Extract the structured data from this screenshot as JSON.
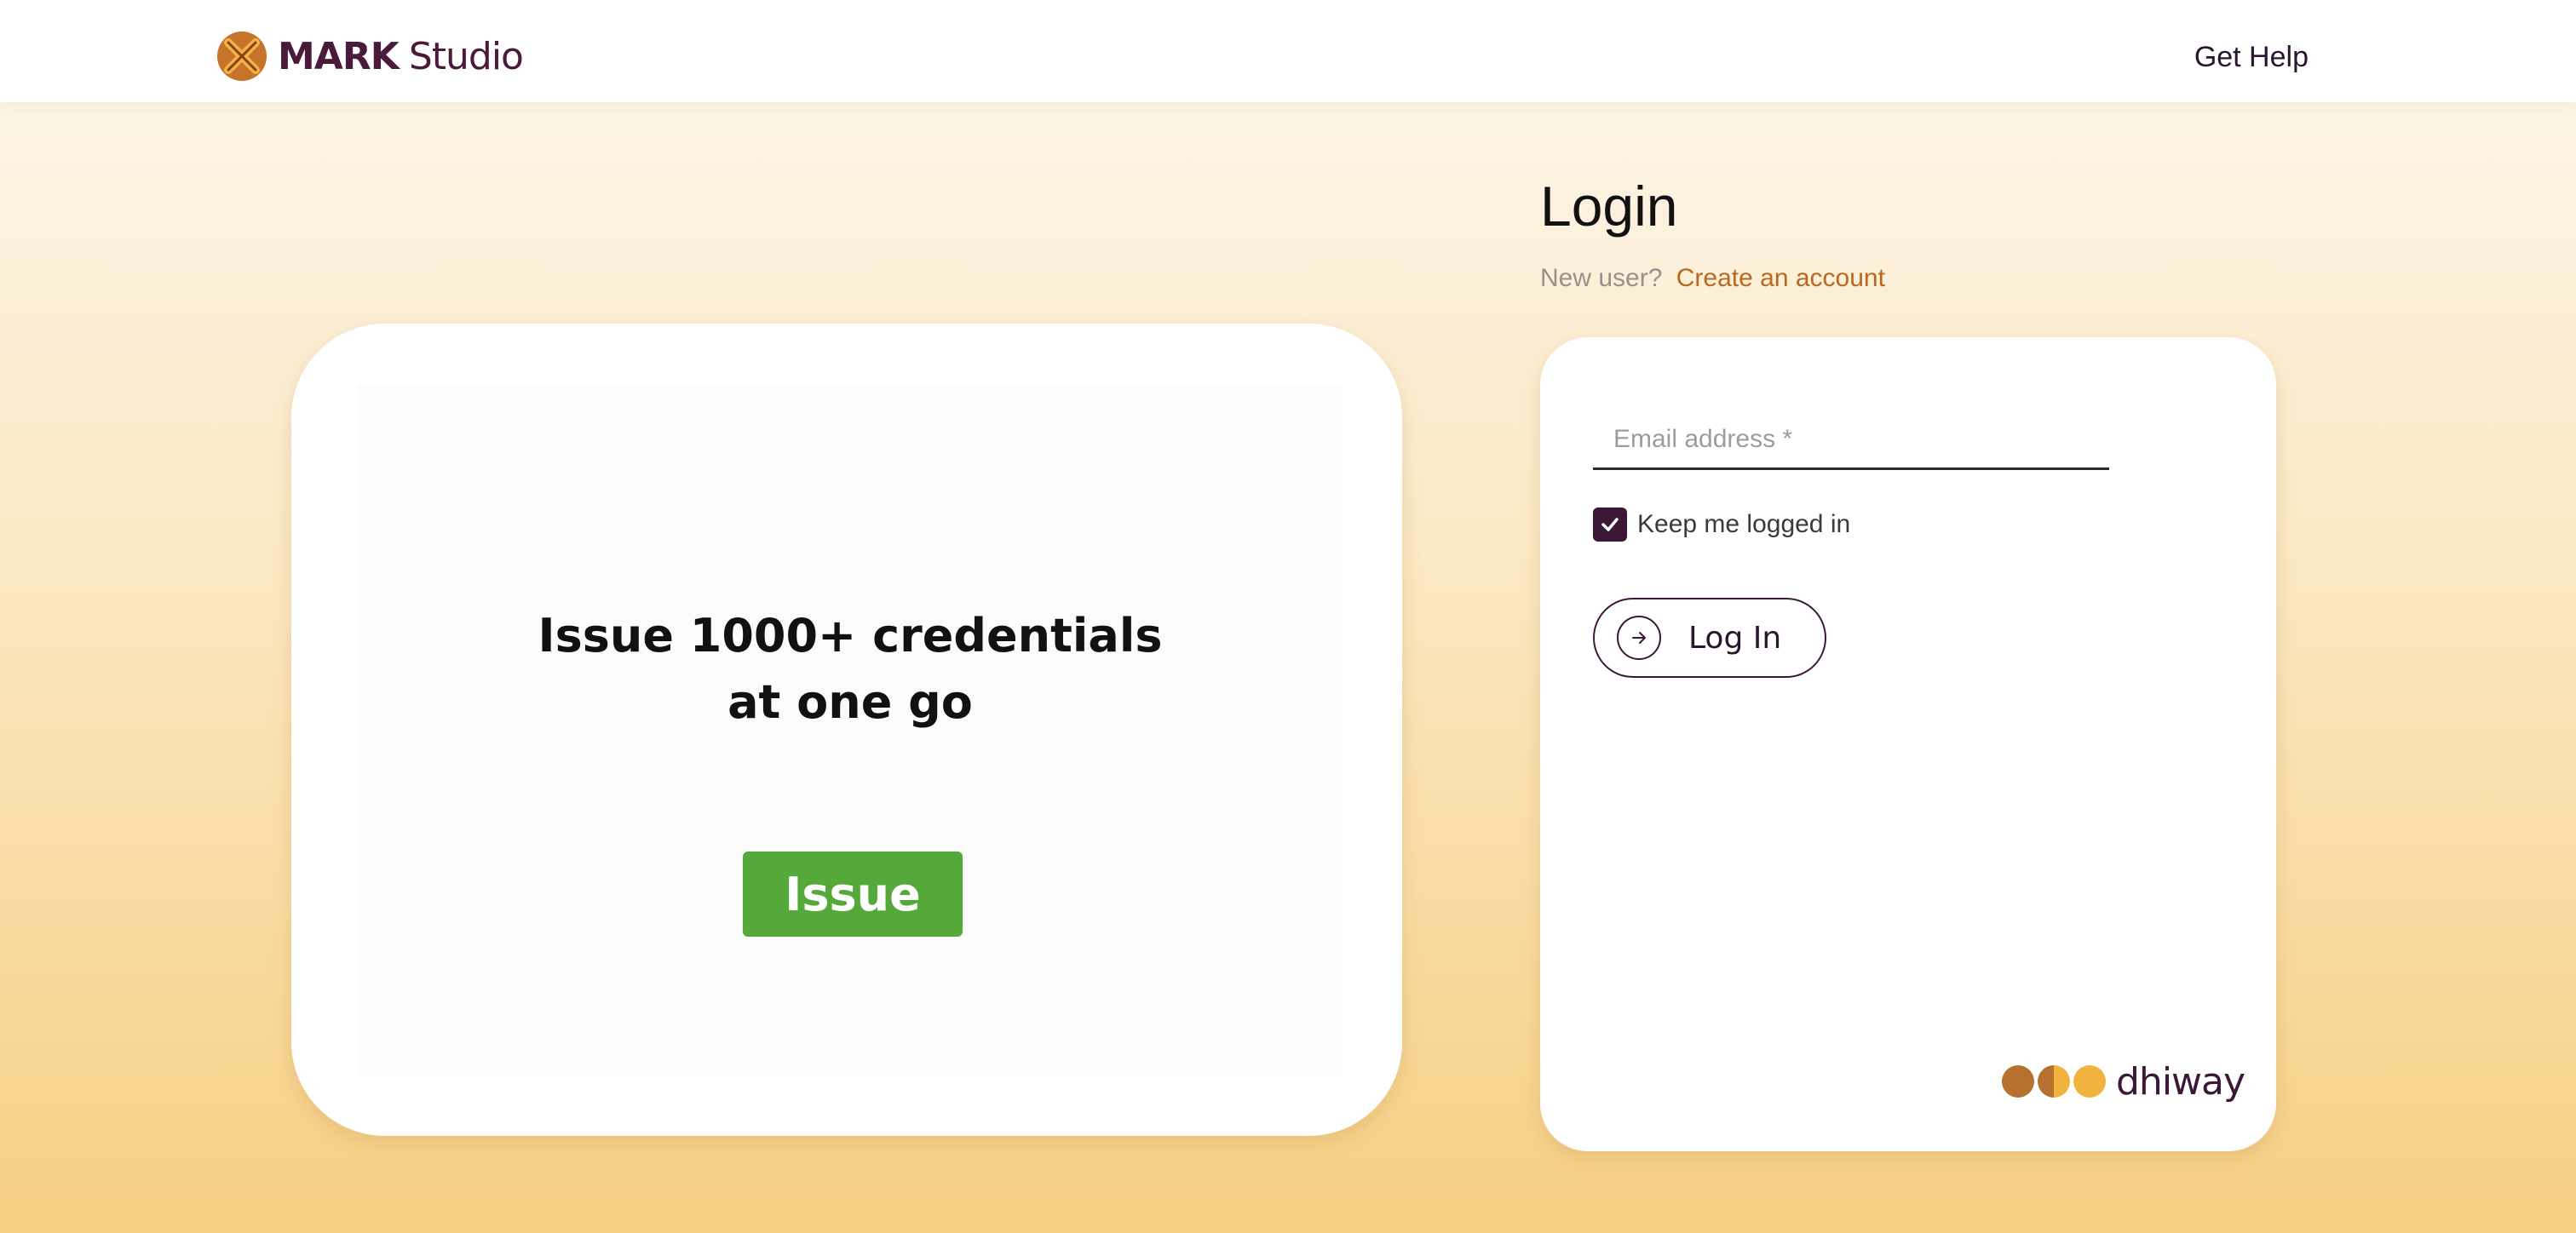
{
  "header": {
    "brand_bold": "MARK",
    "brand_light": "Studio",
    "help_label": "Get Help"
  },
  "promo": {
    "title_line1": "Issue 1000+ credentials",
    "title_line2": "at one go",
    "button_label": "Issue"
  },
  "login": {
    "title": "Login",
    "new_user_prompt": "New user?",
    "create_account_label": "Create an account",
    "email_placeholder": "Email address *",
    "email_value": "",
    "keep_logged_in_label": "Keep me logged in",
    "keep_logged_in_checked": true,
    "submit_label": "Log In"
  },
  "footer_brand": {
    "text": "dhiway",
    "dot_colors": [
      "#b5712d",
      "#c98a3a",
      "#f0b33e"
    ]
  },
  "colors": {
    "brand_dark": "#3b1838",
    "accent_link": "#b8681f",
    "issue_green": "#55a93a"
  },
  "icons": [
    "mark-studio-logo",
    "check-icon",
    "arrow-right-icon"
  ]
}
